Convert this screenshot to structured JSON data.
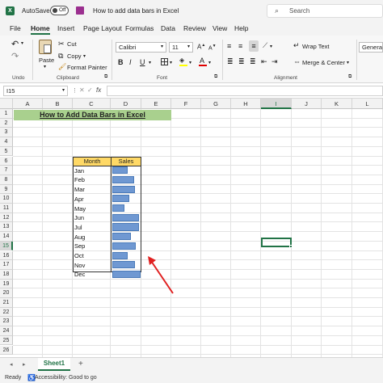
{
  "app": {
    "autosave_label": "AutoSave",
    "autosave_state": "Off",
    "doc_title": "How to add data bars in Excel",
    "search_placeholder": "Search"
  },
  "menu": [
    "File",
    "Home",
    "Insert",
    "Page Layout",
    "Formulas",
    "Data",
    "Review",
    "View",
    "Help"
  ],
  "ribbon": {
    "undo_label": "Undo",
    "paste_label": "Paste",
    "cut_label": "Cut",
    "copy_label": "Copy",
    "format_painter_label": "Format Painter",
    "clipboard_label": "Clipboard",
    "font_name": "Calibri",
    "font_size": "11",
    "font_group_label": "Font",
    "bold": "B",
    "italic": "I",
    "underline": "U",
    "wrap_text_label": "Wrap Text",
    "merge_center_label": "Merge & Center",
    "alignment_label": "Alignment",
    "number_format": "General"
  },
  "formula_bar": {
    "name_box": "I15",
    "fx": "fx",
    "content": ""
  },
  "columns": [
    "A",
    "B",
    "C",
    "D",
    "E",
    "F",
    "G",
    "H",
    "I",
    "J",
    "K",
    "L"
  ],
  "rows": [
    "1",
    "2",
    "3",
    "4",
    "5",
    "6",
    "7",
    "8",
    "9",
    "10",
    "11",
    "12",
    "13",
    "14",
    "15",
    "16",
    "17",
    "18",
    "19",
    "20",
    "21",
    "22",
    "23",
    "24",
    "25",
    "26"
  ],
  "sheet": {
    "title": "How to Add Data Bars in Excel",
    "header_month": "Month",
    "header_sales": "Sales",
    "months": [
      "Jan",
      "Feb",
      "Mar",
      "Apr",
      "May",
      "Jun",
      "Jul",
      "Aug",
      "Sep",
      "Oct",
      "Nov",
      "Dec"
    ],
    "bar_fraction": [
      0.53,
      0.78,
      0.8,
      0.6,
      0.42,
      0.95,
      0.93,
      0.66,
      0.84,
      0.53,
      0.81,
      1.0
    ],
    "selected_cell": "I15"
  },
  "bottom": {
    "sheet_tab": "Sheet1",
    "add_sheet": "+",
    "status_ready": "Ready",
    "accessibility": "Accessibility: Good to go"
  },
  "colors": {
    "excel_green": "#217346",
    "title_fill": "#a9d08e",
    "header_fill": "#ffd966",
    "data_bar": "#6f98d2",
    "arrow": "#e02020"
  }
}
